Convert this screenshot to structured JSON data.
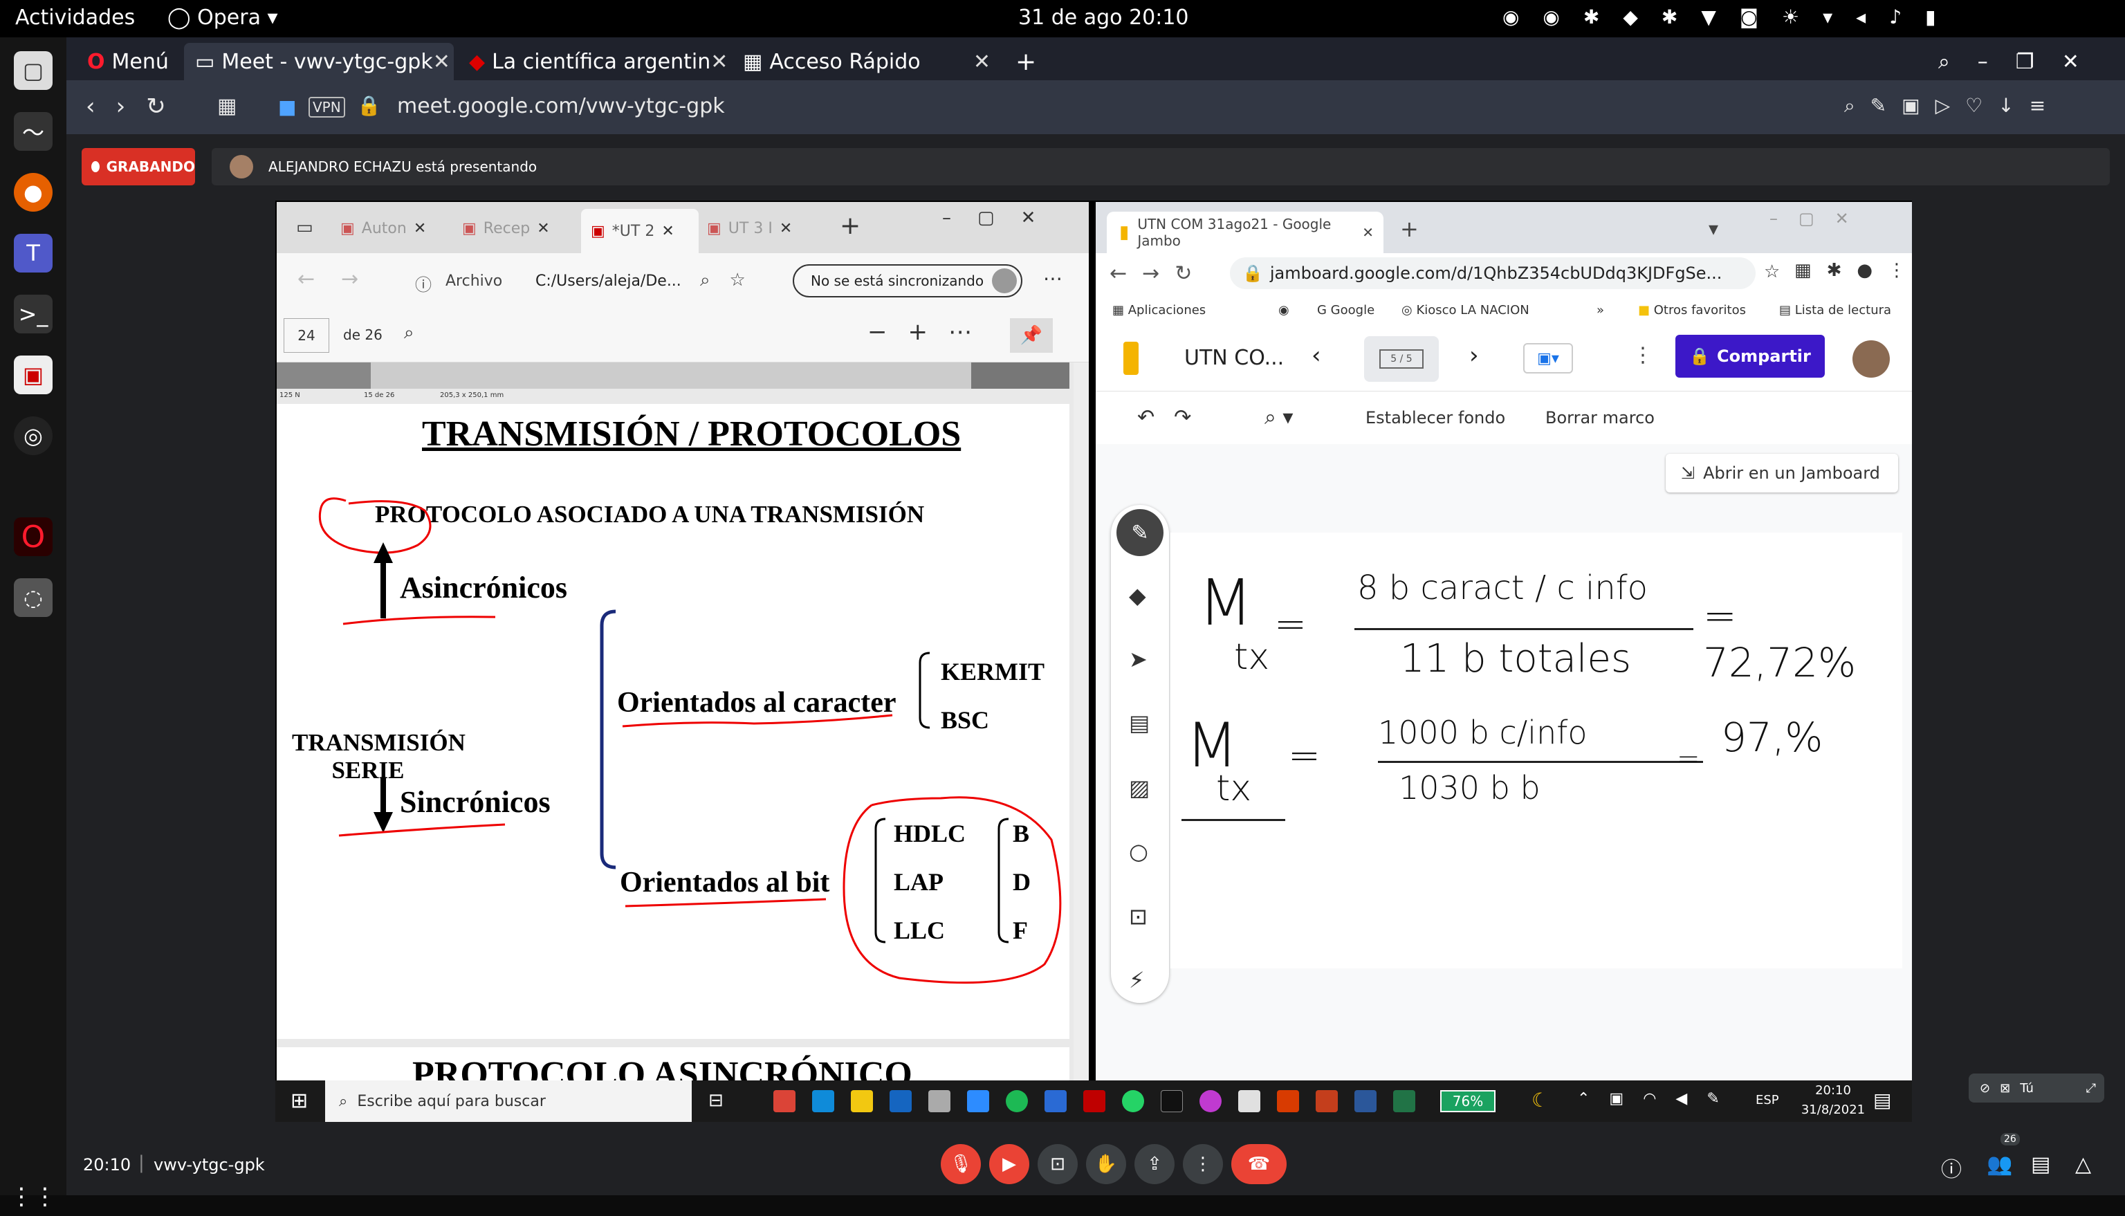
{
  "gnome": {
    "activities": "Actividades",
    "app": "Opera",
    "clock": "31 de ago  20:10"
  },
  "browser": {
    "menu": "Menú",
    "tabs": [
      {
        "label": "Meet - vwv-ytgc-gpk"
      },
      {
        "label": "La científica argentin"
      },
      {
        "label": "Acceso Rápido"
      }
    ],
    "vpn": "VPN",
    "url": "meet.google.com/vwv-ytgc-gpk"
  },
  "meet": {
    "recording": "GRABANDO",
    "presenting": "ALEJANDRO ECHAZU está presentando",
    "time": "20:10",
    "meeting_code": "vwv-ytgc-gpk",
    "participants_count": "26",
    "self_label": "Tú"
  },
  "pdf": {
    "tabs": [
      "Auton",
      "Recep",
      "*UT 2",
      "UT 3 I"
    ],
    "archivo": "Archivo",
    "path": "C:/Users/aleja/De...",
    "sync": "No se está sincronizando",
    "page_num": "24",
    "page_of": "de 26",
    "ruler_text": "125 N",
    "ruler_pages": "15 de 26",
    "ruler_size": "205,3 x 250,1  mm",
    "title": "TRANSMISIÓN / PROTOCOLOS",
    "subtitle": "PROTOCOLO ASOCIADO A UNA TRANSMISIÓN",
    "asinc": "Asincrónicos",
    "trans_serie_1": "TRANSMISIÓN",
    "trans_serie_2": "SERIE",
    "sinc": "Sincrónicos",
    "orient_char": "Orientados al caracter",
    "kermit": "KERMIT",
    "bsc": "BSC",
    "orient_bit": "Orientados al bit",
    "hdlc": "HDLC",
    "lap": "LAP",
    "llc": "LLC",
    "b": "B",
    "d": "D",
    "f": "F",
    "next_title": "PROTOCOLO ASINCRÓNICO"
  },
  "jam": {
    "tab_title": "UTN COM 31ago21 - Google Jambo",
    "url": "jamboard.google.com/d/1QhbZ354cbUDdq3KJDFgSe...",
    "bookmarks": [
      "Aplicaciones",
      "Google",
      "Kiosco LA NACION",
      "Otros favoritos",
      "Lista de lectura"
    ],
    "title": "UTN CO...",
    "frame": "5 / 5",
    "share": "Compartir",
    "set_bg": "Establecer fondo",
    "clear": "Borrar marco",
    "open_in": "Abrir en un Jamboard",
    "hw1_lhs": "M",
    "hw1_sub": "tx",
    "hw1_num": "8 b caract / c info",
    "hw1_den": "11 b totales",
    "hw1_res": "= 72,72%",
    "hw2_num": "1000 b c/info",
    "hw2_den": "1030 b  b",
    "hw2_res": "97,%"
  },
  "taskbar": {
    "search": "Escribe aquí para buscar",
    "battery": "76%",
    "lang": "ESP",
    "time": "20:10",
    "date": "31/8/2021"
  },
  "colors": {
    "accent_red": "#d93025",
    "jam_purple": "#3c18c8",
    "meet_bg": "#202124"
  }
}
